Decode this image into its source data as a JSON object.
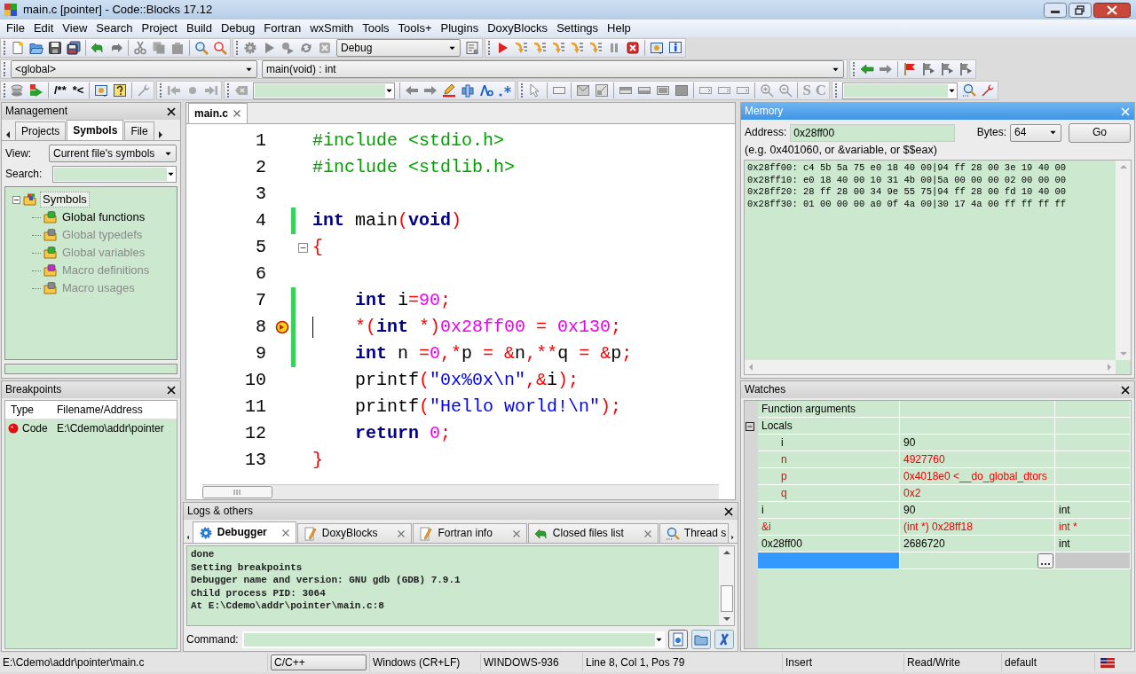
{
  "window": {
    "title": "main.c [pointer] - Code::Blocks 17.12"
  },
  "menu": [
    "File",
    "Edit",
    "View",
    "Search",
    "Project",
    "Build",
    "Debug",
    "Fortran",
    "wxSmith",
    "Tools",
    "Tools+",
    "Plugins",
    "DoxyBlocks",
    "Settings",
    "Help"
  ],
  "toolbar": {
    "build_target": "Debug",
    "scope": "<global>",
    "function": "main(void) : int",
    "comment_buttons": [
      "/**",
      "*<"
    ],
    "letter_buttons": [
      "S",
      "C"
    ]
  },
  "management": {
    "title": "Management",
    "active": false,
    "tabs": [
      {
        "label": "Projects",
        "selected": false
      },
      {
        "label": "Symbols",
        "selected": true
      },
      {
        "label": "File",
        "selected": false
      }
    ],
    "view_label": "View:",
    "view_value": "Current file's symbols",
    "search_label": "Search:",
    "tree": [
      {
        "label": "Symbols",
        "selected": true,
        "disabled": false,
        "expanded": true,
        "children": [
          {
            "label": "Global functions",
            "selected": false,
            "disabled": false
          },
          {
            "label": "Global typedefs",
            "selected": false,
            "disabled": true
          },
          {
            "label": "Global variables",
            "selected": false,
            "disabled": true
          },
          {
            "label": "Macro definitions",
            "selected": false,
            "disabled": true
          },
          {
            "label": "Macro usages",
            "selected": false,
            "disabled": true
          }
        ]
      }
    ]
  },
  "breakpoints": {
    "title": "Breakpoints",
    "active": false,
    "columns": [
      "Type",
      "Filename/Address"
    ],
    "rows": [
      {
        "type": "Code",
        "file": "E:\\Cdemo\\addr\\pointer"
      }
    ]
  },
  "editor": {
    "tabs": [
      {
        "label": "main.c",
        "selected": true
      }
    ],
    "lines": [
      {
        "number": "1",
        "changed": false,
        "fold": false,
        "current": false,
        "indent": false,
        "tokens": [
          {
            "kind": "pp",
            "text": "#include <stdio.h>"
          }
        ]
      },
      {
        "number": "2",
        "changed": false,
        "fold": false,
        "current": false,
        "indent": false,
        "tokens": [
          {
            "kind": "pp",
            "text": "#include <stdlib.h>"
          }
        ]
      },
      {
        "number": "3",
        "changed": false,
        "fold": false,
        "current": false,
        "indent": false
      },
      {
        "number": "4",
        "changed": true,
        "fold": false,
        "current": false,
        "indent": false,
        "tokens": [
          {
            "kind": "kw",
            "text": "int"
          },
          {
            "kind": "id",
            "text": " main"
          },
          {
            "kind": "op",
            "text": "("
          },
          {
            "kind": "kw",
            "text": "void"
          },
          {
            "kind": "op",
            "text": ")"
          }
        ]
      },
      {
        "number": "5",
        "changed": false,
        "fold": true,
        "current": false,
        "indent": false,
        "tokens": [
          {
            "kind": "op",
            "text": "{"
          }
        ]
      },
      {
        "number": "6",
        "changed": false,
        "fold": false,
        "current": false,
        "indent": false
      },
      {
        "number": "7",
        "changed": true,
        "fold": false,
        "current": false,
        "indent": true,
        "tokens": [
          {
            "kind": "kw",
            "text": "int"
          },
          {
            "kind": "id",
            "text": " i"
          },
          {
            "kind": "op",
            "text": "="
          },
          {
            "kind": "num",
            "text": "90"
          },
          {
            "kind": "op",
            "text": ";"
          }
        ]
      },
      {
        "number": "8",
        "changed": true,
        "fold": false,
        "current": true,
        "indent": true,
        "tokens": [
          {
            "kind": "op",
            "text": "*("
          },
          {
            "kind": "kw",
            "text": "int"
          },
          {
            "kind": "op",
            "text": " *)"
          },
          {
            "kind": "num",
            "text": "0x28ff00"
          },
          {
            "kind": "op",
            "text": " = "
          },
          {
            "kind": "num",
            "text": "0x130"
          },
          {
            "kind": "op",
            "text": ";"
          }
        ]
      },
      {
        "number": "9",
        "changed": true,
        "fold": false,
        "current": false,
        "indent": true,
        "tokens": [
          {
            "kind": "kw",
            "text": "int"
          },
          {
            "kind": "id",
            "text": " n "
          },
          {
            "kind": "op",
            "text": "="
          },
          {
            "kind": "num",
            "text": "0"
          },
          {
            "kind": "op",
            "text": ",*"
          },
          {
            "kind": "id",
            "text": "p "
          },
          {
            "kind": "op",
            "text": "= &"
          },
          {
            "kind": "id",
            "text": "n"
          },
          {
            "kind": "op",
            "text": ",**"
          },
          {
            "kind": "id",
            "text": "q "
          },
          {
            "kind": "op",
            "text": "= &"
          },
          {
            "kind": "id",
            "text": "p"
          },
          {
            "kind": "op",
            "text": ";"
          }
        ]
      },
      {
        "number": "10",
        "changed": false,
        "fold": false,
        "current": false,
        "indent": true,
        "tokens": [
          {
            "kind": "id",
            "text": "printf"
          },
          {
            "kind": "op",
            "text": "("
          },
          {
            "kind": "str",
            "text": "\"0x%0x\\n\""
          },
          {
            "kind": "op",
            "text": ",&"
          },
          {
            "kind": "id",
            "text": "i"
          },
          {
            "kind": "op",
            "text": ");"
          }
        ]
      },
      {
        "number": "11",
        "changed": false,
        "fold": false,
        "current": false,
        "indent": true,
        "tokens": [
          {
            "kind": "id",
            "text": "printf"
          },
          {
            "kind": "op",
            "text": "("
          },
          {
            "kind": "str",
            "text": "\"Hello world!\\n\""
          },
          {
            "kind": "op",
            "text": ");"
          }
        ]
      },
      {
        "number": "12",
        "changed": false,
        "fold": false,
        "current": false,
        "indent": true,
        "tokens": [
          {
            "kind": "kw",
            "text": "return"
          },
          {
            "kind": "num",
            "text": " 0"
          },
          {
            "kind": "op",
            "text": ";"
          }
        ]
      },
      {
        "number": "13",
        "changed": false,
        "fold": false,
        "current": false,
        "indent": false,
        "tokens": [
          {
            "kind": "op",
            "text": "}"
          }
        ]
      }
    ]
  },
  "logs": {
    "title": "Logs & others",
    "active": false,
    "tabs": [
      {
        "label": "Debugger",
        "selected": true
      },
      {
        "label": "DoxyBlocks",
        "selected": false
      },
      {
        "label": "Fortran info",
        "selected": false
      },
      {
        "label": "Closed files list",
        "selected": false
      },
      {
        "label": "Thread s",
        "selected": false
      }
    ],
    "lines": [
      "done",
      "Setting breakpoints",
      "Debugger name and version: GNU gdb (GDB) 7.9.1",
      "Child process PID: 3064",
      "At E:\\Cdemo\\addr\\pointer\\main.c:8"
    ],
    "command_label": "Command:"
  },
  "memory": {
    "title": "Memory",
    "active": true,
    "address_label": "Address:",
    "address": "0x28ff00",
    "bytes_label": "Bytes:",
    "bytes": "64",
    "go": "Go",
    "hint": "(e.g. 0x401060, or &variable, or $$eax)",
    "dump": [
      "0x28ff00: c4 5b 5a 75 e0 18 40 00|94 ff 28 00 3e 19 40 00",
      "0x28ff10: e0 18 40 00 10 31 4b 00|5a 00 00 00 02 00 00 00",
      "0x28ff20: 28 ff 28 00 34 9e 55 75|94 ff 28 00 fd 10 40 00",
      "0x28ff30: 01 00 00 00 a0 0f 4a 00|30 17 4a 00 ff ff ff ff"
    ]
  },
  "watches": {
    "title": "Watches",
    "active": false,
    "rows": [
      {
        "name": "Function arguments",
        "changed": false
      },
      {
        "name": "Locals",
        "changed": false,
        "expanded": true,
        "children": [
          {
            "name": "i",
            "value": "90",
            "changed": false
          },
          {
            "name": "n",
            "value": "4927760",
            "changed": true
          },
          {
            "name": "p",
            "value": "0x4018e0 <__do_global_dtors",
            "changed": true
          },
          {
            "name": "q",
            "value": "0x2",
            "changed": true
          }
        ]
      },
      {
        "name": "i",
        "value": "90",
        "type": "int",
        "changed": false
      },
      {
        "name": "&i",
        "value": "(int *) 0x28ff18",
        "type": "int *",
        "changed": true
      },
      {
        "name": "0x28ff00",
        "value": "2686720",
        "type": "int",
        "changed": false
      },
      {
        "kind": "new"
      }
    ]
  },
  "status_bar": [
    {
      "kind": "text",
      "text": "E:\\Cdemo\\addr\\pointer\\main.c"
    },
    {
      "kind": "button",
      "text": "C/C++"
    },
    {
      "kind": "text",
      "text": "Windows (CR+LF)"
    },
    {
      "kind": "text",
      "text": "WINDOWS-936"
    },
    {
      "kind": "text",
      "text": "Line 8, Col 1, Pos 79"
    },
    {
      "kind": "text",
      "text": "Insert"
    },
    {
      "kind": "text",
      "text": "Read/Write"
    },
    {
      "kind": "text",
      "text": "default"
    }
  ]
}
